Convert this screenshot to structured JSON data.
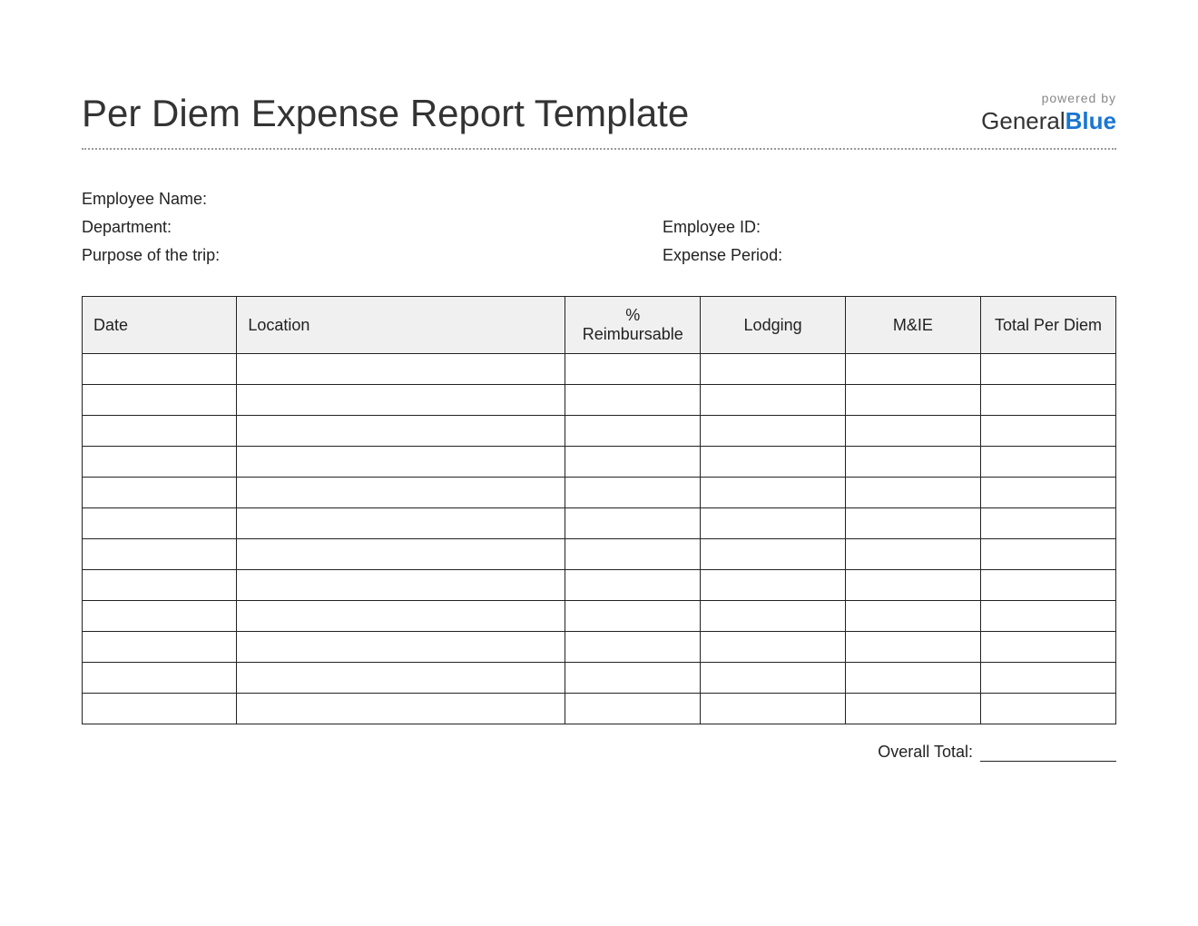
{
  "header": {
    "title": "Per Diem Expense Report Template",
    "powered_by": "powered by",
    "brand_a": "General",
    "brand_b": "Blue"
  },
  "info": {
    "employee_name_label": "Employee Name:",
    "department_label": "Department:",
    "employee_id_label": "Employee ID:",
    "purpose_label": "Purpose of the trip:",
    "expense_period_label": "Expense Period:"
  },
  "table": {
    "columns": {
      "date": "Date",
      "location": "Location",
      "reimbursable": "% Reimbursable",
      "lodging": "Lodging",
      "mie": "M&IE",
      "total": "Total Per Diem"
    },
    "rows": [
      {
        "date": "",
        "location": "",
        "reimbursable": "",
        "lodging": "",
        "mie": "",
        "total": ""
      },
      {
        "date": "",
        "location": "",
        "reimbursable": "",
        "lodging": "",
        "mie": "",
        "total": ""
      },
      {
        "date": "",
        "location": "",
        "reimbursable": "",
        "lodging": "",
        "mie": "",
        "total": ""
      },
      {
        "date": "",
        "location": "",
        "reimbursable": "",
        "lodging": "",
        "mie": "",
        "total": ""
      },
      {
        "date": "",
        "location": "",
        "reimbursable": "",
        "lodging": "",
        "mie": "",
        "total": ""
      },
      {
        "date": "",
        "location": "",
        "reimbursable": "",
        "lodging": "",
        "mie": "",
        "total": ""
      },
      {
        "date": "",
        "location": "",
        "reimbursable": "",
        "lodging": "",
        "mie": "",
        "total": ""
      },
      {
        "date": "",
        "location": "",
        "reimbursable": "",
        "lodging": "",
        "mie": "",
        "total": ""
      },
      {
        "date": "",
        "location": "",
        "reimbursable": "",
        "lodging": "",
        "mie": "",
        "total": ""
      },
      {
        "date": "",
        "location": "",
        "reimbursable": "",
        "lodging": "",
        "mie": "",
        "total": ""
      },
      {
        "date": "",
        "location": "",
        "reimbursable": "",
        "lodging": "",
        "mie": "",
        "total": ""
      },
      {
        "date": "",
        "location": "",
        "reimbursable": "",
        "lodging": "",
        "mie": "",
        "total": ""
      }
    ]
  },
  "footer": {
    "overall_total_label": "Overall Total:",
    "overall_total_value": ""
  }
}
